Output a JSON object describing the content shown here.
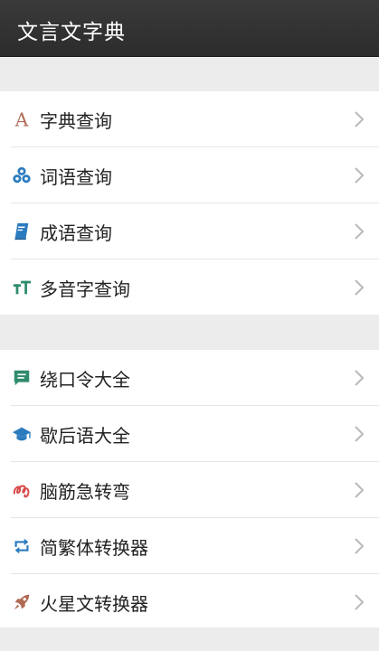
{
  "app": {
    "title": "文言文字典"
  },
  "groups": [
    {
      "items": [
        {
          "label": "字典查询",
          "icon": "letter-a-icon",
          "color": "#b06a55"
        },
        {
          "label": "词语查询",
          "icon": "cubes-icon",
          "color": "#2b7bbf"
        },
        {
          "label": "成语查询",
          "icon": "book-icon",
          "color": "#2b7bbf"
        },
        {
          "label": "多音字查询",
          "icon": "text-height-icon",
          "color": "#2e8b6b"
        }
      ]
    },
    {
      "items": [
        {
          "label": "绕口令大全",
          "icon": "comment-icon",
          "color": "#2e8b6b"
        },
        {
          "label": "歇后语大全",
          "icon": "graduation-cap-icon",
          "color": "#2b7bbf"
        },
        {
          "label": "脑筋急转弯",
          "icon": "squiggle-icon",
          "color": "#d64a4a"
        },
        {
          "label": "简繁体转换器",
          "icon": "retweet-icon",
          "color": "#2b7bbf"
        },
        {
          "label": "火星文转换器",
          "icon": "rocket-icon",
          "color": "#b06a55"
        }
      ]
    }
  ]
}
